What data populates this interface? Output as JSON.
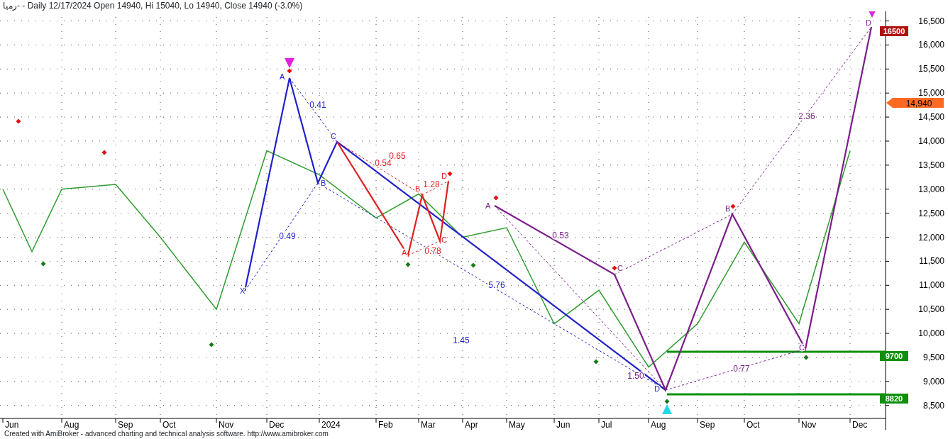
{
  "header": {
    "symbol": "رميا-",
    "title": " - Daily 12/17/2024 Open 14940, Hi 15040, Lo 14940, Close 14940 (-3.0%)"
  },
  "chart": {
    "chart_data": {
      "type": "line",
      "categories": [
        "Jun",
        null,
        "Aug",
        "Sep",
        "Oct",
        "Nov",
        "Dec",
        "2024",
        "Feb",
        "Mar",
        "Apr",
        "May",
        "Jun",
        "Jul",
        "Aug",
        "Sep",
        "Oct",
        "Nov",
        "Dec"
      ],
      "series": [
        {
          "color": "#2e9b2e",
          "values": [
            13000,
            11700,
            13000,
            13100,
            12000,
            10500,
            13800,
            13300,
            12400,
            12900,
            12000,
            12200,
            10200,
            10900,
            9300,
            10200,
            11900,
            10200,
            13800
          ]
        }
      ],
      "ylim": [
        8230,
        16700
      ],
      "grid": true,
      "yticks": [
        {
          "value": 8500,
          "label": "8,500"
        },
        {
          "value": 9000,
          "label": "9,000"
        },
        {
          "value": 9500,
          "label": "9,500"
        },
        {
          "value": 10000,
          "label": "10,000"
        },
        {
          "value": 10500,
          "label": "10,500"
        },
        {
          "value": 11000,
          "label": "11,000"
        },
        {
          "value": 11500,
          "label": "11,500"
        },
        {
          "value": 12000,
          "label": "12,000"
        },
        {
          "value": 12500,
          "label": "12,500"
        },
        {
          "value": 13000,
          "label": "13,000"
        },
        {
          "value": 13500,
          "label": "13,500"
        },
        {
          "value": 14000,
          "label": "14,000"
        },
        {
          "value": 14500,
          "label": "14,500"
        },
        {
          "value": 15000,
          "label": "15,000"
        },
        {
          "value": 15500,
          "label": "15,500"
        },
        {
          "value": 16000,
          "label": "16,000"
        },
        {
          "value": 16500,
          "label": "16,500"
        }
      ]
    },
    "patterns": [
      {
        "color": "#2222cc",
        "labels": [
          "X",
          "A",
          "B",
          "C",
          "D"
        ],
        "ratios": [
          "0.41",
          "0.49",
          "5.76",
          "1.45"
        ]
      },
      {
        "color": "#e02020",
        "labels": [
          "A",
          "B",
          "C",
          "D"
        ],
        "ratios": [
          "0.65",
          "0.54",
          "1.28",
          "0.78"
        ]
      },
      {
        "color": "#7b1f8a",
        "labels": [
          "A",
          "C",
          "B",
          "C",
          "D"
        ],
        "ratios": [
          "0.53",
          "1.50",
          "0.77",
          "2.36"
        ]
      }
    ],
    "price_tags": [
      {
        "text": "16500",
        "color": "#b01010"
      },
      {
        "text": "9700",
        "color": "#0f8f0f"
      },
      {
        "text": "8820",
        "color": "#0f8f0f"
      }
    ],
    "last_price": {
      "text": "14,940"
    }
  },
  "footer": {
    "text": "Created with AmiBroker - advanced charting and technical analysis software. http://www.amibroker.com"
  }
}
